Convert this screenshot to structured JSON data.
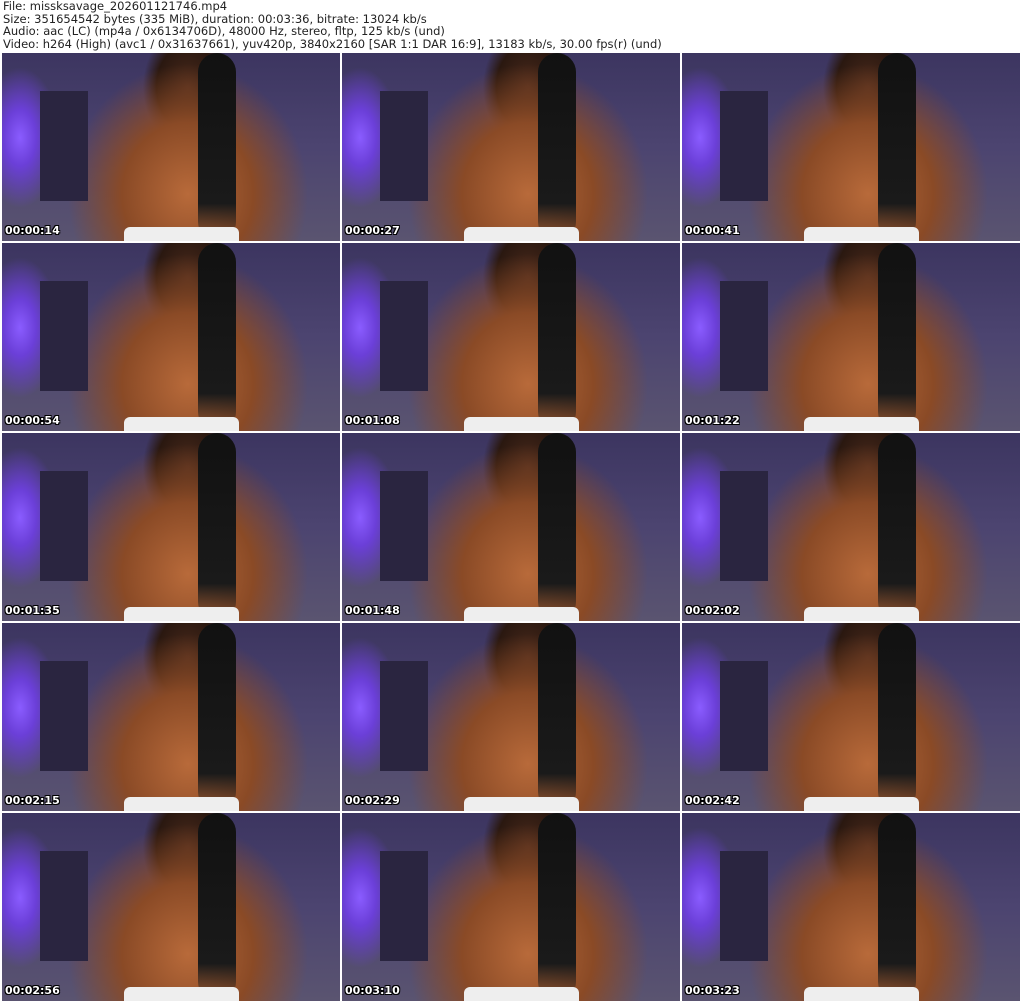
{
  "info": {
    "file": "File: missksavage_202601121746.mp4",
    "size": "Size: 351654542 bytes (335 MiB), duration: 00:03:36, bitrate: 13024 kb/s",
    "audio": "Audio: aac (LC) (mp4a / 0x6134706D), 48000 Hz, stereo, fltp, 125 kb/s (und)",
    "video": "Video: h264 (High) (avc1 / 0x31637661), yuv420p, 3840x2160 [SAR 1:1 DAR 16:9], 13183 kb/s, 30.00 fps(r) (und)"
  },
  "thumbnails": [
    {
      "time": "00:00:14"
    },
    {
      "time": "00:00:27"
    },
    {
      "time": "00:00:41"
    },
    {
      "time": "00:00:54"
    },
    {
      "time": "00:01:08"
    },
    {
      "time": "00:01:22"
    },
    {
      "time": "00:01:35"
    },
    {
      "time": "00:01:48"
    },
    {
      "time": "00:02:02"
    },
    {
      "time": "00:02:15"
    },
    {
      "time": "00:02:29"
    },
    {
      "time": "00:02:42"
    },
    {
      "time": "00:02:56"
    },
    {
      "time": "00:03:10"
    },
    {
      "time": "00:03:23"
    }
  ]
}
